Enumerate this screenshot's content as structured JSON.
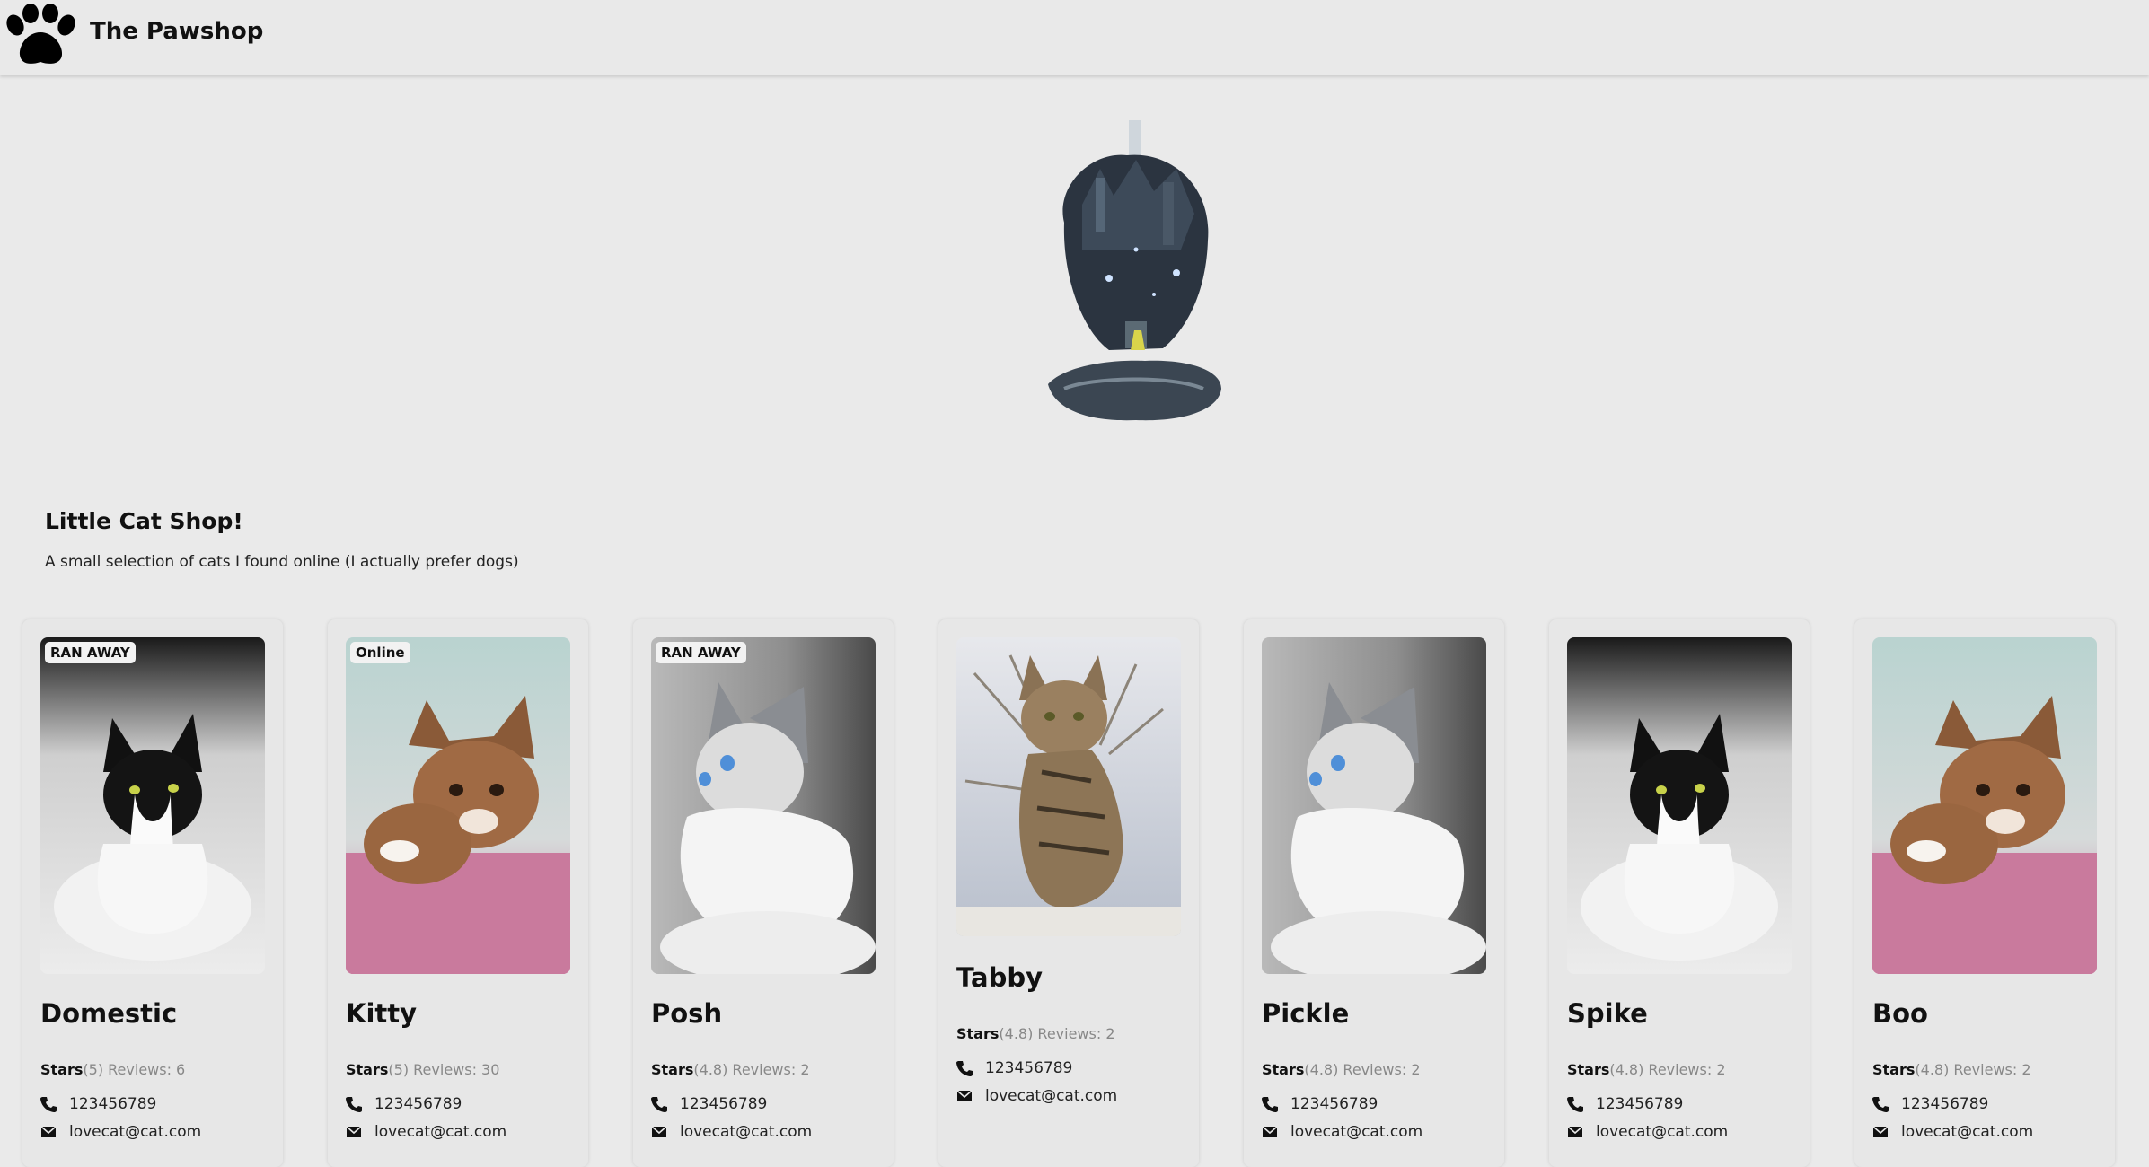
{
  "header": {
    "brand": "The Pawshop",
    "logo_icon": "paw-icon"
  },
  "intro": {
    "title": "Little Cat Shop!",
    "subtitle": "A small selection of cats I found online (I actually prefer dogs)"
  },
  "cards": [
    {
      "badge": "RAN AWAY",
      "name": "Domestic",
      "stars_label": "Stars",
      "rating": "(5)",
      "reviews": "Reviews: 6",
      "phone": "123456789",
      "email": "lovecat@cat.com"
    },
    {
      "badge": "Online",
      "name": "Kitty",
      "stars_label": "Stars",
      "rating": "(5)",
      "reviews": "Reviews: 30",
      "phone": "123456789",
      "email": "lovecat@cat.com"
    },
    {
      "badge": "RAN AWAY",
      "name": "Posh",
      "stars_label": "Stars",
      "rating": "(4.8)",
      "reviews": "Reviews: 2",
      "phone": "123456789",
      "email": "lovecat@cat.com"
    },
    {
      "badge": "",
      "name": "Tabby",
      "stars_label": "Stars",
      "rating": "(4.8)",
      "reviews": "Reviews: 2",
      "phone": "123456789",
      "email": "lovecat@cat.com"
    },
    {
      "badge": "",
      "name": "Pickle",
      "stars_label": "Stars",
      "rating": "(4.8)",
      "reviews": "Reviews: 2",
      "phone": "123456789",
      "email": "lovecat@cat.com"
    },
    {
      "badge": "",
      "name": "Spike",
      "stars_label": "Stars",
      "rating": "(4.8)",
      "reviews": "Reviews: 2",
      "phone": "123456789",
      "email": "lovecat@cat.com"
    },
    {
      "badge": "",
      "name": "Boo",
      "stars_label": "Stars",
      "rating": "(4.8)",
      "reviews": "Reviews: 2",
      "phone": "123456789",
      "email": "lovecat@cat.com"
    }
  ]
}
